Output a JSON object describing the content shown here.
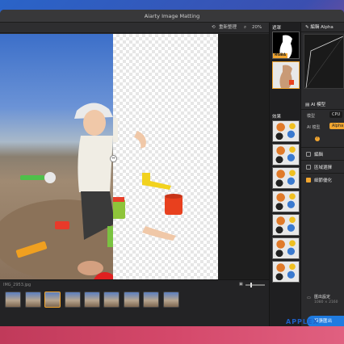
{
  "window": {
    "title": "Aiarty Image Matting"
  },
  "toolbar": {
    "reset_label": "重新整理",
    "zoom": "20%"
  },
  "filmstrip": {
    "path": "IMG_2953.jpg",
    "thumb_count": 9,
    "active_index": 2
  },
  "strip": {
    "mask_label": "遮罩",
    "rgba_tag": "RGBA",
    "effect_label": "效果"
  },
  "panel": {
    "alpha_title": "編輯 Alpha",
    "ai_section": "AI 模型",
    "model_label": "模型",
    "model_value": "CPU",
    "ai_model_label": "AI 模型",
    "ai_model_value": "Alpha",
    "edit_label": "編輯",
    "region_label": "區域選擇",
    "refine_label": "細節優化",
    "output_label": "匯出設定",
    "output_size": "1080 × 2160",
    "export_label": "單張匯出"
  },
  "colors": {
    "accent": "#f2a630",
    "export": "#1f7be0",
    "window": "#2b2b2d"
  },
  "watermark": "APPLEX"
}
